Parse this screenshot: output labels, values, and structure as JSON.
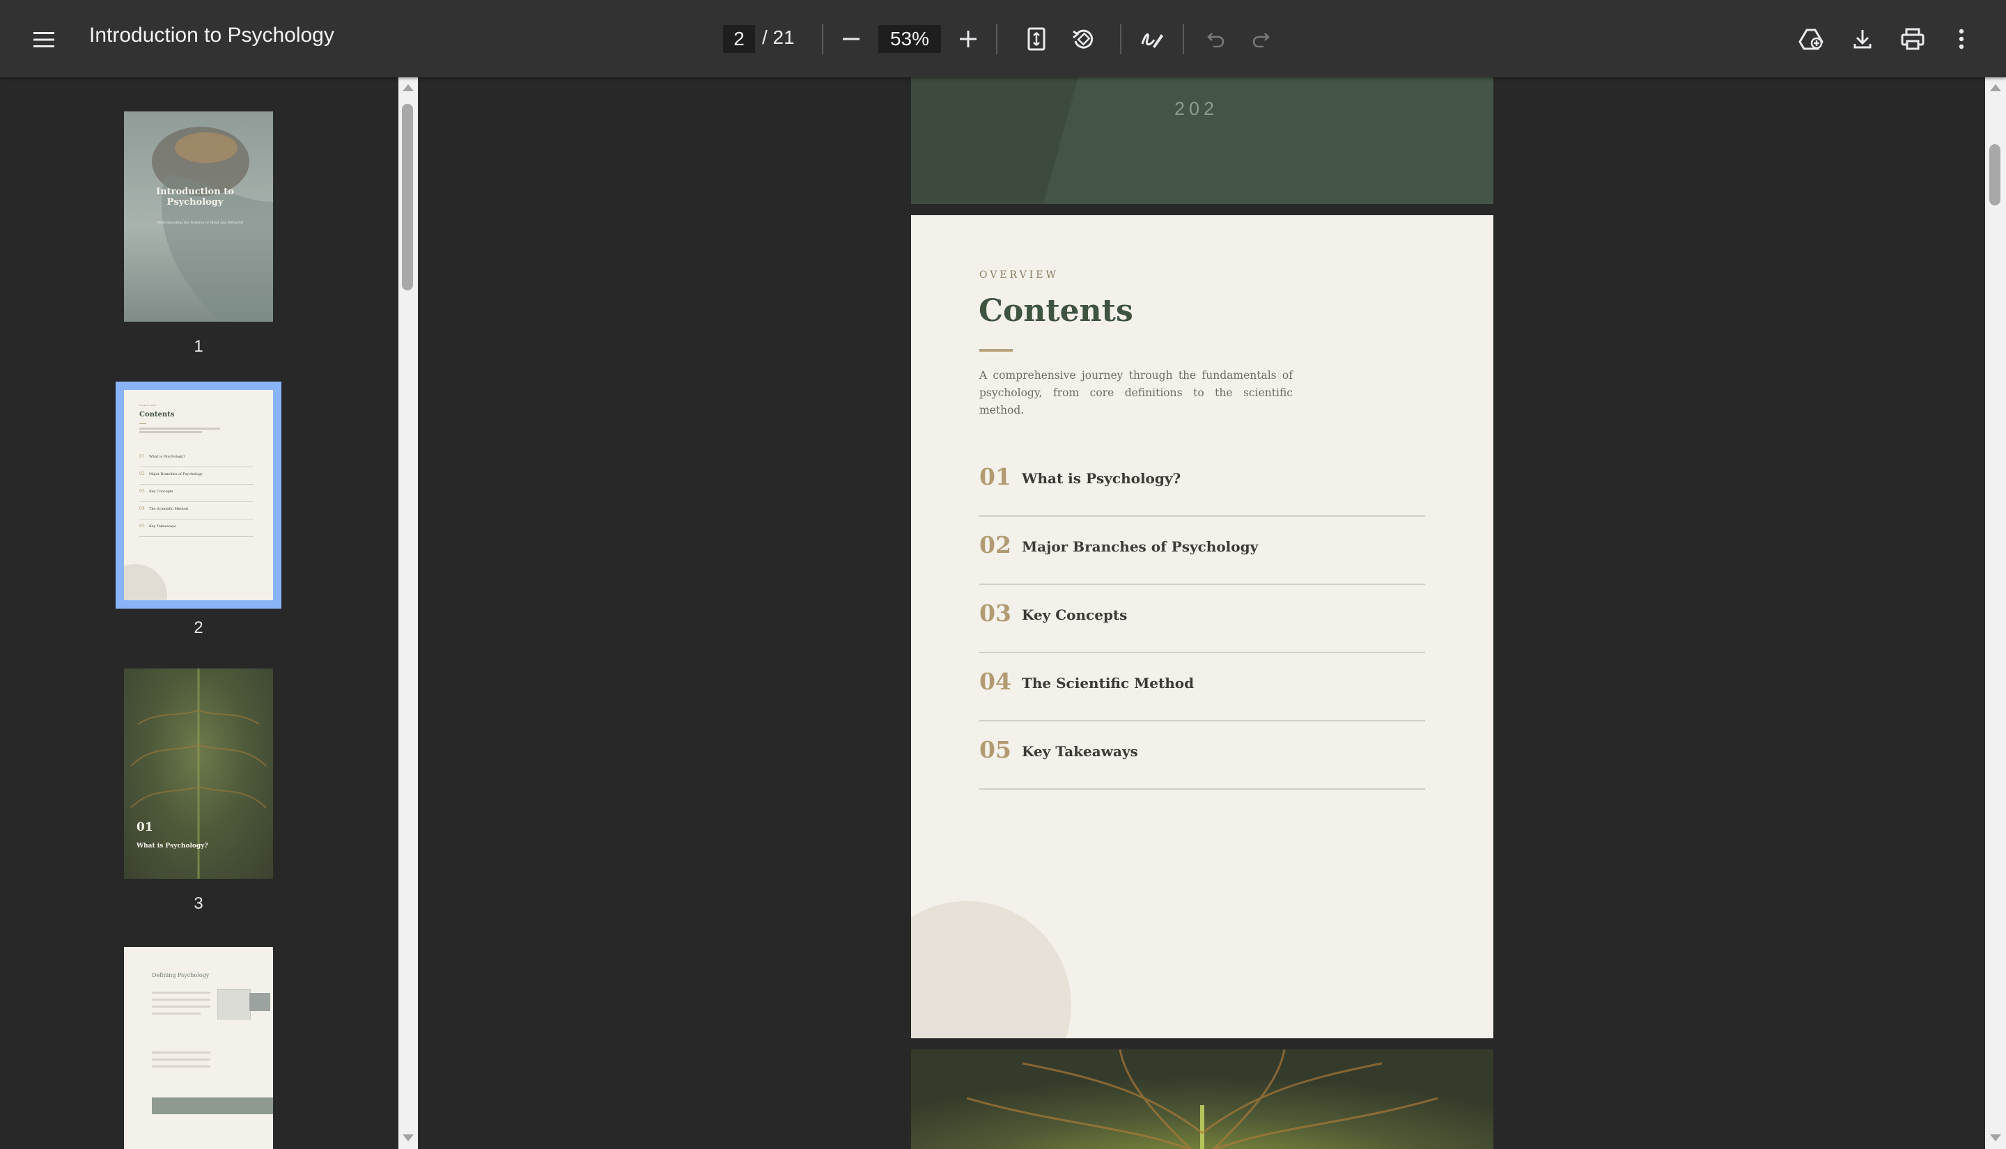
{
  "toolbar": {
    "title": "Introduction to Psychology",
    "current_page": "2",
    "total_pages": "/ 21",
    "zoom": "53%"
  },
  "thumbnails": [
    {
      "number": "1",
      "title": "Introduction to Psychology",
      "subtitle": "Understanding the Science of Mind and Behavior"
    },
    {
      "number": "2",
      "selected": true,
      "label": "OVERVIEW",
      "title": "Contents",
      "items": [
        "What is Psychology?",
        "Major Branches of Psychology",
        "Key Concepts",
        "The Scientific Method",
        "Key Takeaways"
      ]
    },
    {
      "number": "3",
      "chapter": "01",
      "title": "What is Psychology?"
    },
    {
      "number": "4",
      "title": "Defining Psychology"
    }
  ],
  "page1_tail": {
    "text": "202"
  },
  "page2": {
    "eyebrow": "OVERVIEW",
    "title": "Contents",
    "intro": "A comprehensive journey through the fundamentals of psychology, from core definitions to the scientific method.",
    "toc": [
      {
        "num": "01",
        "label": "What is Psychology?"
      },
      {
        "num": "02",
        "label": "Major Branches of Psychology"
      },
      {
        "num": "03",
        "label": "Key Concepts"
      },
      {
        "num": "04",
        "label": "The Scientific Method"
      },
      {
        "num": "05",
        "label": "Key Takeaways"
      }
    ]
  },
  "colors": {
    "toolbar": "#323232",
    "background": "#282828",
    "selection": "#8ab4f8",
    "heading_green": "#3f5440",
    "accent_gold": "#b29b72"
  }
}
